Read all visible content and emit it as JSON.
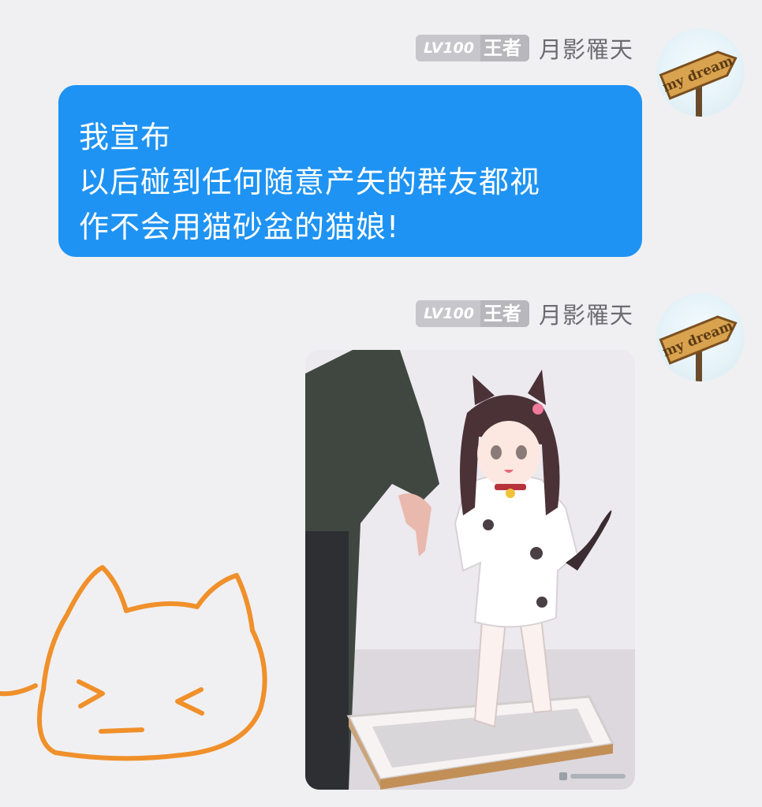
{
  "messages": [
    {
      "sender": {
        "level": "LV100",
        "rank": "王者",
        "name": "月影罹天",
        "avatar_text": "my dream"
      },
      "type": "text",
      "lines": [
        "我宣布",
        "以后碰到任何随意产矢的群友都视",
        "作不会用猫砂盆的猫娘!"
      ]
    },
    {
      "sender": {
        "level": "LV100",
        "rank": "王者",
        "name": "月影罹天",
        "avatar_text": "my dream"
      },
      "type": "image",
      "image_subject": "anime-catgirl-litter-box-illustration"
    }
  ],
  "colors": {
    "background": "#f0f0f2",
    "bubble": "#1e93f3",
    "doodle": "#f0902a"
  }
}
